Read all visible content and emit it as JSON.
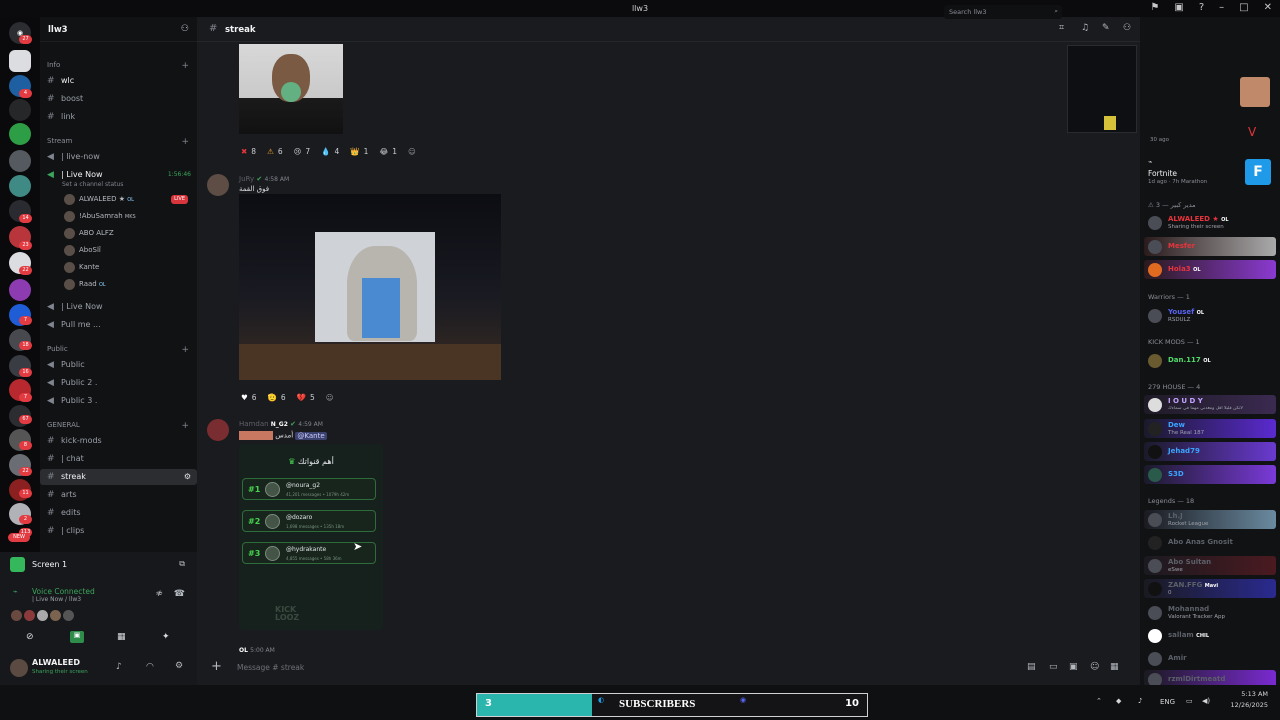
{
  "window": {
    "title": "llw3"
  },
  "guild_badges": [
    "27",
    "4",
    "14",
    "23",
    "22",
    "7",
    "18",
    "16",
    "7",
    "67",
    "8",
    "22",
    "11",
    "2",
    "113",
    "NEW"
  ],
  "server": {
    "name": "llw3"
  },
  "channels": {
    "cat_info": "Info",
    "wlc": "wlc",
    "boost": "boost",
    "link": "link",
    "cat_stream": "Stream",
    "live_now": "| live-now",
    "voice_live": "| Live Now",
    "voice_timer": "1:56:46",
    "set_status": "Set a channel status",
    "voice_users": [
      {
        "name": "ALWALEED ★",
        "tag": "OL",
        "live": "LIVE"
      },
      {
        "name": "!AbuSamrah",
        "tag": "MKS"
      },
      {
        "name": "ABO ALFZ"
      },
      {
        "name": "AboSlî"
      },
      {
        "name": "Kante"
      },
      {
        "name": "Raad",
        "tag": "OL"
      }
    ],
    "voice_live2": "| Live Now",
    "pull_me": "Pull me ...",
    "cat_public": "Public",
    "public1": "Public",
    "public2": "Public 2 .",
    "public3": "Public 3 .",
    "cat_general": "GENERAL",
    "kick_mods": "kick-mods",
    "chat": "| chat",
    "streak": "streak",
    "arts": "arts",
    "edits": "edits",
    "clips": "| clips"
  },
  "voice_panel": {
    "screen": "Screen 1",
    "connected": "Voice Connected",
    "where": "| Live Now / llw3",
    "user": "ALWALEED",
    "user_status": "Sharing their screen"
  },
  "chat": {
    "channel": "streak",
    "search_placeholder": "Search llw3",
    "reactions1": [
      {
        "emoji": "✖",
        "count": "8"
      },
      {
        "emoji": "⚠",
        "count": "6"
      },
      {
        "emoji": "😢",
        "count": "7"
      },
      {
        "emoji": "💧",
        "count": "4"
      },
      {
        "emoji": "👑",
        "count": "1"
      },
      {
        "emoji": "😂",
        "count": "1"
      }
    ],
    "msg1": {
      "author": "JuRy",
      "time": "4:58 AM",
      "text": "فوق القمة"
    },
    "reactions2": [
      {
        "emoji": "♥",
        "count": "6"
      },
      {
        "emoji": "🫡",
        "count": "6"
      },
      {
        "emoji": "💔",
        "count": "5"
      }
    ],
    "msg2": {
      "author": "Hamdan",
      "tag": "N_G2",
      "time": "4:59 AM",
      "text": "أمدس",
      "mention": "@Kante"
    },
    "card": {
      "title": "أهم قنواتك",
      "items": [
        {
          "rank": "#1",
          "name": "@noura_g2",
          "stats": "41,201 messages • 1079h 42m"
        },
        {
          "rank": "#2",
          "name": "@dozaro",
          "stats": "1,698 messages • 135h 18m"
        },
        {
          "rank": "#3",
          "name": "@hydrakante",
          "stats": "4,855 messages • 58h 36m"
        }
      ],
      "watermark": "KICK LOOZ"
    },
    "msg3": {
      "tag": "OL",
      "time": "5:00 AM"
    },
    "input_placeholder": "Message # streak"
  },
  "members": {
    "stream_time": "30 ago",
    "game": "Fortnite",
    "game_time": "1d ago",
    "game_mode": "7h Marathon",
    "groups": [
      {
        "title": "⚠ 3 — مدير كبير",
        "members": [
          {
            "name": "ALWALEED ★",
            "tag": "OL",
            "status": "Sharing their screen",
            "color": "#e7343c"
          },
          {
            "name": "Mesfer",
            "color": "#e7343c"
          },
          {
            "name": "Hola3",
            "tag": "OL",
            "color": "#e7343c"
          }
        ]
      },
      {
        "title": "Warriors — 1",
        "members": [
          {
            "name": "Yousef",
            "tag": "OL",
            "status": "RSDULZ",
            "color": "#5865f2"
          }
        ]
      },
      {
        "title": "KICK MODS — 1",
        "members": [
          {
            "name": "Dan.117",
            "tag": "OL",
            "color": "#53d969"
          }
        ]
      },
      {
        "title": "279 HOUSE — 4",
        "members": [
          {
            "name": "I O U D Y",
            "status": "لاتكن قليلا أقل ومعدني مهما في سماءك",
            "color": "#c3a3ff"
          },
          {
            "name": "Dew",
            "status": "The Real 187",
            "color": "#3aa5ff"
          },
          {
            "name": "Jehad79",
            "color": "#3aa5ff"
          },
          {
            "name": "S3D",
            "color": "#3aa5ff"
          }
        ]
      },
      {
        "title": "Legends — 18",
        "members": [
          {
            "name": "Lh.J",
            "status": "Rocket League",
            "color": "#8a8e96"
          },
          {
            "name": "Abo Anas Gnosit",
            "color": "#8a8e96"
          },
          {
            "name": "Abo Sultan",
            "status": "eSwe",
            "color": "#8a8e96"
          },
          {
            "name": "ZAN.FFG",
            "tag": "Mavi",
            "status": "0",
            "color": "#8a8e96"
          },
          {
            "name": "Mohannad",
            "status": "Valorant Tracker App",
            "color": "#8a8e96"
          },
          {
            "name": "sallam",
            "tag": "CHIL",
            "color": "#8a8e96"
          },
          {
            "name": "Amir",
            "color": "#8a8e96"
          },
          {
            "name": "rzmlDirtmeatd",
            "color": "#8a8e96"
          }
        ]
      }
    ]
  },
  "taskbar": {
    "left_num": "3",
    "subscribers": "SUBSCRIBERS",
    "right_num": "10",
    "lang": "ENG",
    "time": "5:13 AM",
    "date": "12/26/2025"
  }
}
